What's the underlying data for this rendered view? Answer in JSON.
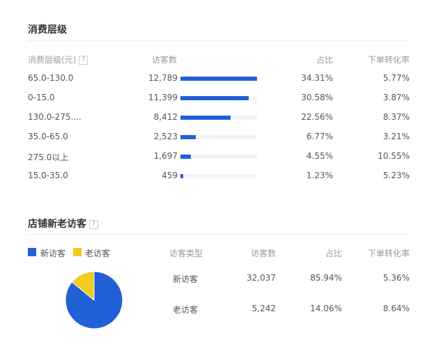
{
  "colors": {
    "blue": "#2260d8",
    "yellow": "#f2cb22"
  },
  "tier": {
    "title": "消费层级",
    "headers": {
      "tier": "消费层级(元)",
      "help": "?",
      "visitors": "访客数",
      "share": "占比",
      "rate": "下单转化率"
    },
    "rows": [
      {
        "tier": "65.0-130.0",
        "visitors": "12,789",
        "visitors_num": 12789,
        "share": "34.31%",
        "rate": "5.77%"
      },
      {
        "tier": "0-15.0",
        "visitors": "11,399",
        "visitors_num": 11399,
        "share": "30.58%",
        "rate": "3.87%"
      },
      {
        "tier": "130.0-275....",
        "visitors": "8,412",
        "visitors_num": 8412,
        "share": "22.56%",
        "rate": "8.37%"
      },
      {
        "tier": "35.0-65.0",
        "visitors": "2,523",
        "visitors_num": 2523,
        "share": "6.77%",
        "rate": "3.21%"
      },
      {
        "tier": "275.0以上",
        "visitors": "1,697",
        "visitors_num": 1697,
        "share": "4.55%",
        "rate": "10.55%"
      },
      {
        "tier": "15.0-35.0",
        "visitors": "459",
        "visitors_num": 459,
        "share": "1.23%",
        "rate": "5.23%"
      }
    ]
  },
  "visitors": {
    "title": "店铺新老访客",
    "help": "?",
    "headers": {
      "type": "访客类型",
      "visitors": "访客数",
      "share": "占比",
      "rate": "下单转化率"
    },
    "rows": [
      {
        "type": "新访客",
        "visitors": "32,037",
        "share": "85.94%",
        "rate": "5.36%"
      },
      {
        "type": "老访客",
        "visitors": "5,242",
        "share": "14.06%",
        "rate": "8.64%"
      }
    ]
  },
  "chart_data": {
    "type": "pie",
    "legend": [
      "新访客",
      "老访客"
    ],
    "legend_placement": "top-left",
    "values": [
      85.94,
      14.06
    ],
    "colors": [
      "#2260d8",
      "#f2cb22"
    ]
  }
}
